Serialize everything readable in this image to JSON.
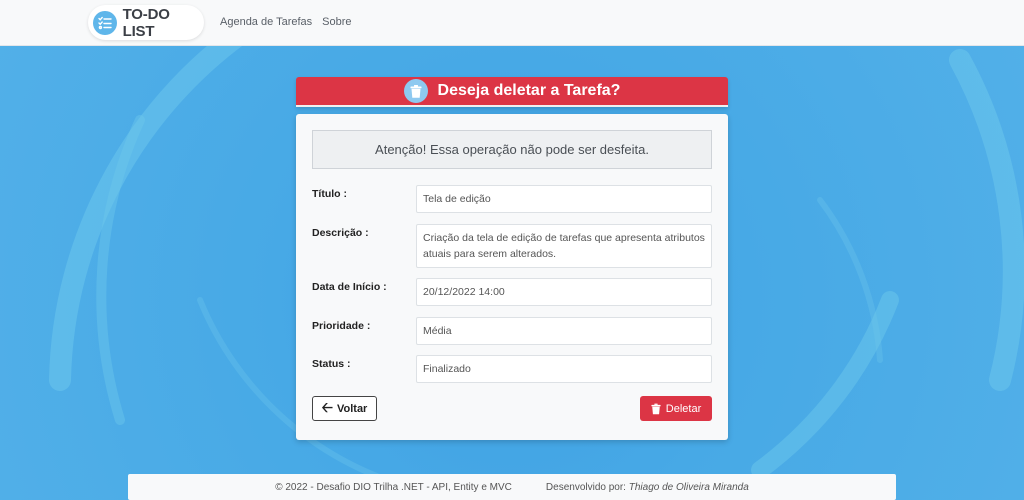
{
  "navbar": {
    "brand": "TO-DO LIST",
    "links": [
      "Agenda de Tarefas",
      "Sobre"
    ]
  },
  "dialog": {
    "title": "Deseja deletar a Tarefa?",
    "warning": "Atenção! Essa operação não pode ser desfeita.",
    "fields": [
      {
        "label": "Título :",
        "value": "Tela de edição"
      },
      {
        "label": "Descrição :",
        "value": "Criação da tela de edição de tarefas que apresenta atributos atuais para serem alterados."
      },
      {
        "label": "Data de Início :",
        "value": "20/12/2022 14:00"
      },
      {
        "label": "Prioridade :",
        "value": "Média"
      },
      {
        "label": "Status :",
        "value": "Finalizado"
      }
    ],
    "back_label": "Voltar",
    "delete_label": "Deletar"
  },
  "footer": {
    "left": "© 2022 - Desafio DIO Trilha .NET - API, Entity e MVC",
    "right_prefix": "Desenvolvido por:",
    "author": "Thiago de Oliveira Miranda"
  },
  "colors": {
    "danger": "#dc3545",
    "background": "#4aa8e4",
    "accent": "#5fb6ea"
  },
  "icons": {
    "brand": "checklist-icon",
    "header": "trash-icon",
    "back": "arrow-left-icon",
    "delete": "trash-icon"
  }
}
